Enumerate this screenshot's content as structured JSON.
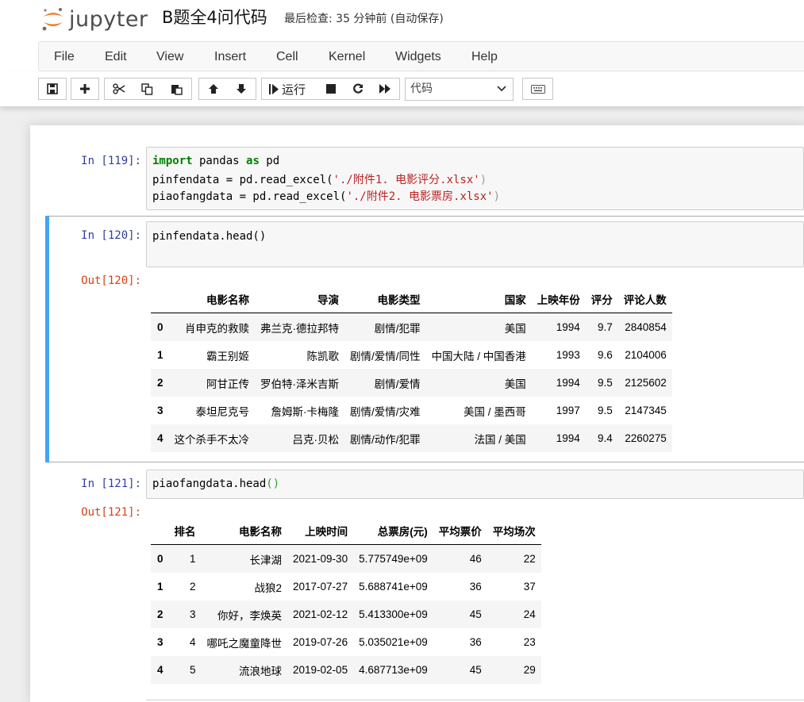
{
  "header": {
    "logo_text": "jupyter",
    "notebook_title": "B题全4问代码",
    "save_status": "最后检查: 35 分钟前  (自动保存)"
  },
  "menu": [
    "File",
    "Edit",
    "View",
    "Insert",
    "Cell",
    "Kernel",
    "Widgets",
    "Help"
  ],
  "toolbar": {
    "run_label": "运行",
    "cell_type": "代码",
    "icons": [
      "save-icon",
      "plus-icon",
      "scissors-icon",
      "copy-icon",
      "paste-icon",
      "arrow-up-icon",
      "arrow-down-icon",
      "run-icon",
      "stop-icon",
      "restart-icon",
      "fast-forward-icon",
      "keyboard-icon"
    ]
  },
  "cells": [
    {
      "in_prompt": "In  [119]:",
      "lines": [
        {
          "kw1": "import",
          "t1": " pandas ",
          "kw2": "as",
          "t2": " pd"
        },
        {
          "t": "pinfendata = pd.read_excel(",
          "s": "'./附件1. 电影评分.xlsx'",
          "e": ")"
        },
        {
          "t": "piaofangdata = pd.read_excel(",
          "s": "'./附件2. 电影票房.xlsx'",
          "e": ")"
        }
      ]
    },
    {
      "in_prompt": "In  [120]:",
      "code": "pinfendata.head()",
      "out_prompt": "Out[120]:",
      "table": {
        "columns": [
          "",
          "电影名称",
          "导演",
          "电影类型",
          "国家",
          "上映年份",
          "评分",
          "评论人数"
        ],
        "rows": [
          [
            "0",
            "肖申克的救赎",
            "弗兰克·德拉邦特",
            "剧情/犯罪",
            "美国",
            "1994",
            "9.7",
            "2840854"
          ],
          [
            "1",
            "霸王别姬",
            "陈凯歌",
            "剧情/爱情/同性",
            "中国大陆 / 中国香港",
            "1993",
            "9.6",
            "2104006"
          ],
          [
            "2",
            "阿甘正传",
            "罗伯特·泽米吉斯",
            "剧情/爱情",
            "美国",
            "1994",
            "9.5",
            "2125602"
          ],
          [
            "3",
            "泰坦尼克号",
            "詹姆斯·卡梅隆",
            "剧情/爱情/灾难",
            "美国 / 墨西哥",
            "1997",
            "9.5",
            "2147345"
          ],
          [
            "4",
            "这个杀手不太冷",
            "吕克·贝松",
            "剧情/动作/犯罪",
            "法国 / 美国",
            "1994",
            "9.4",
            "2260275"
          ]
        ]
      }
    },
    {
      "in_prompt": "In  [121]:",
      "code": "piaofangdata.head",
      "code_parens": "()",
      "out_prompt": "Out[121]:",
      "table": {
        "columns": [
          "",
          "排名",
          "电影名称",
          "上映时间",
          "总票房(元)",
          "平均票价",
          "平均场次"
        ],
        "rows": [
          [
            "0",
            "1",
            "长津湖",
            "2021-09-30",
            "5.775749e+09",
            "46",
            "22"
          ],
          [
            "1",
            "2",
            "战狼2",
            "2017-07-27",
            "5.688741e+09",
            "36",
            "37"
          ],
          [
            "2",
            "3",
            "你好，李焕英",
            "2021-02-12",
            "5.413300e+09",
            "45",
            "24"
          ],
          [
            "3",
            "4",
            "哪吒之魔童降世",
            "2019-07-26",
            "5.035021e+09",
            "36",
            "23"
          ],
          [
            "4",
            "5",
            "流浪地球",
            "2019-02-05",
            "4.687713e+09",
            "45",
            "29"
          ]
        ]
      }
    }
  ]
}
